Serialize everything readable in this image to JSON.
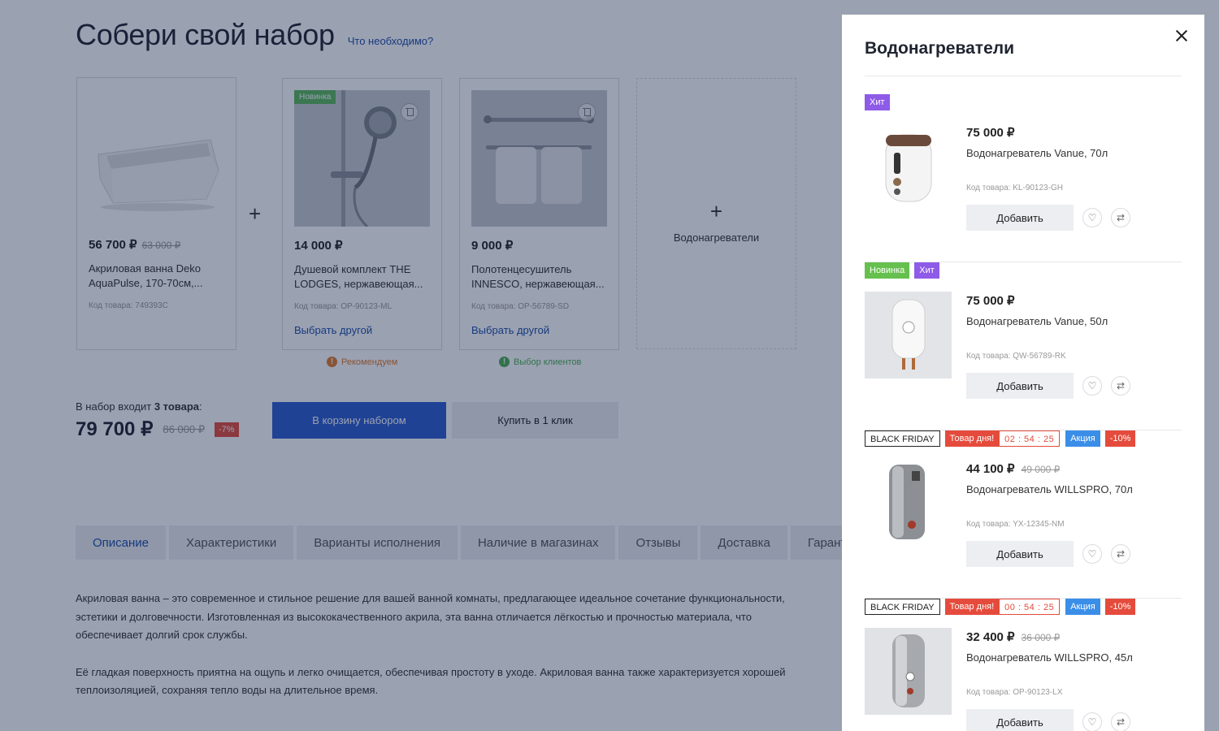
{
  "page": {
    "title": "Собери свой набор",
    "need_link": "Что необходимо?",
    "cards": [
      {
        "price": "56 700 ₽",
        "old_price": "63 000 ₽",
        "name": "Акриловая ванна Deko AquaPulse, 170-70см,...",
        "code": "Код товара: 749393C",
        "choose": ""
      },
      {
        "price": "14 000 ₽",
        "old_price": "",
        "name": "Душевой комплект THE LODGES, нержавеющая...",
        "code": "Код товара: OP-90123-ML",
        "choose": "Выбрать другой",
        "badge": "Новинка"
      },
      {
        "price": "9 000 ₽",
        "old_price": "",
        "name": "Полотенцесушитель INNESCO, нержавеющая...",
        "code": "Код товара: OP-56789-SD",
        "choose": "Выбрать другой"
      }
    ],
    "placeholder_label": "Водонагреватели",
    "notes": [
      "Рекомендуем",
      "Выбор клиентов"
    ],
    "set_info_prefix": "В набор входит ",
    "set_info_count": "3 товара",
    "set_info_suffix": ":",
    "set_total": "79 700 ₽",
    "set_old_total": "86 000 ₽",
    "set_discount": "-7%",
    "btn_cart": "В корзину набором",
    "btn_oneclick": "Купить в 1 клик",
    "tabs": [
      "Описание",
      "Характеристики",
      "Варианты исполнения",
      "Наличие в магазинах",
      "Отзывы",
      "Доставка",
      "Гарант"
    ],
    "description": [
      "Акриловая ванна – это современное и стильное решение для вашей ванной комнаты, предлагающее идеальное сочетание функциональности, эстетики и долговечности. Изготовленная из высококачественного акрила, эта ванна отличается лёгкостью и прочностью материала, что обеспечивает долгий срок службы.",
      "Её гладкая поверхность приятна на ощупь и легко очищается, обеспечивая простоту в уходе. Акриловая ванна также характеризуется хорошей теплоизоляцией, сохраняя тепло воды на длительное время."
    ]
  },
  "drawer": {
    "title": "Водонагреватели",
    "add_label": "Добавить",
    "items": [
      {
        "badges": {
          "hit": "Хит"
        },
        "price": "75 000 ₽",
        "old_price": "",
        "name": "Водонагреватель Vanue, 70л",
        "code": "Код товара: KL-90123-GH"
      },
      {
        "badges": {
          "new": "Новинка",
          "hit": "Хит"
        },
        "price": "75 000 ₽",
        "old_price": "",
        "name": "Водонагреватель Vanue, 50л",
        "code": "Код товара: QW-56789-RK"
      },
      {
        "badges": {
          "bf": "BLACK FRIDAY",
          "day": "Товар дня!",
          "timer": "02 : 54 : 25",
          "sale": "Акция",
          "disc": "-10%"
        },
        "price": "44 100 ₽",
        "old_price": "49 000 ₽",
        "name": "Водонагреватель WILLSPRO, 70л",
        "code": "Код товара: YX-12345-NM"
      },
      {
        "badges": {
          "bf": "BLACK FRIDAY",
          "day": "Товар дня!",
          "timer": "00 : 54 : 25",
          "sale": "Акция",
          "disc": "-10%"
        },
        "price": "32 400 ₽",
        "old_price": "36 000 ₽",
        "name": "Водонагреватель WILLSPRO, 45л",
        "code": "Код товара: OP-90123-LX"
      }
    ]
  },
  "colors": {
    "accent": "#2b5ccf",
    "link": "#1e4fa8",
    "hit": "#8e5be8",
    "new": "#66c04d",
    "red": "#e54b3c",
    "sale": "#3b8ee8",
    "overlay": "#0f1e46"
  },
  "icons": [
    "close-icon",
    "trash-icon",
    "plus-icon",
    "heart-icon",
    "compare-icon",
    "info-icon"
  ]
}
